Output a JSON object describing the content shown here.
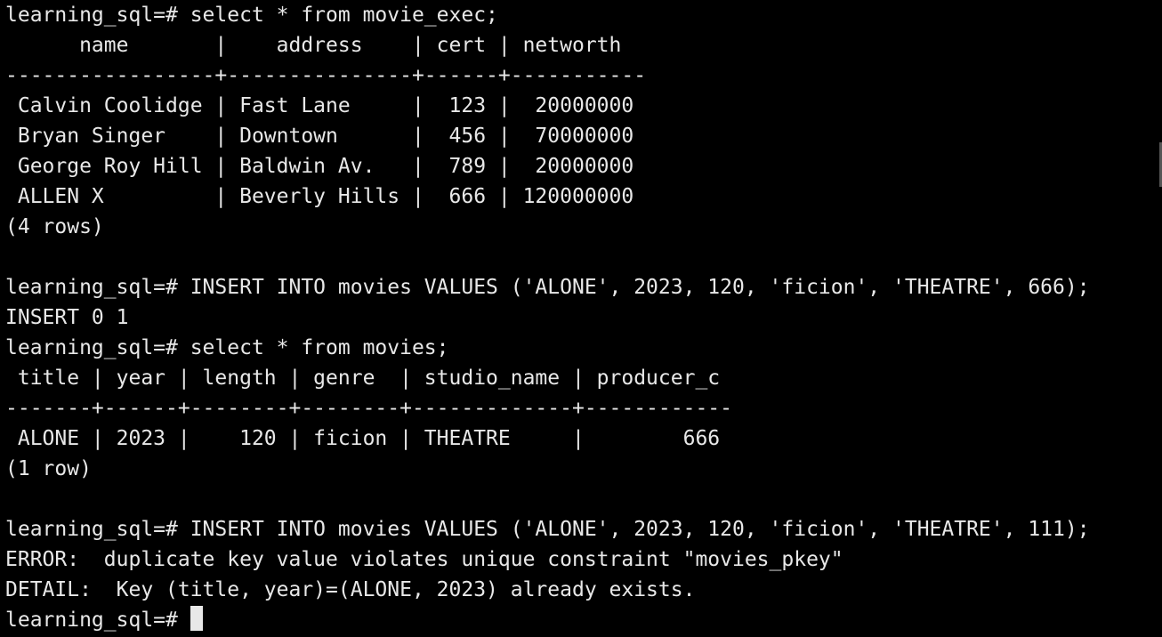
{
  "terminal": {
    "prompt": "learning_sql=# ",
    "lines": [
      "learning_sql=# select * from movie_exec;",
      "      name       |    address    | cert | networth",
      "-----------------+---------------+------+-----------",
      " Calvin Coolidge | Fast Lane     |  123 |  20000000",
      " Bryan Singer    | Downtown      |  456 |  70000000",
      " George Roy Hill | Baldwin Av.   |  789 |  20000000",
      " ALLEN X         | Beverly Hills |  666 | 120000000",
      "(4 rows)",
      "",
      "learning_sql=# INSERT INTO movies VALUES ('ALONE', 2023, 120, 'ficion', 'THEATRE', 666);",
      "INSERT 0 1",
      "learning_sql=# select * from movies;",
      " title | year | length | genre  | studio_name | producer_c",
      "-------+------+--------+--------+-------------+------------",
      " ALONE | 2023 |    120 | ficion | THEATRE     |        666",
      "(1 row)",
      "",
      "learning_sql=# INSERT INTO movies VALUES ('ALONE', 2023, 120, 'ficion', 'THEATRE', 111);",
      "ERROR:  duplicate key value violates unique constraint \"movies_pkey\"",
      "DETAIL:  Key (title, year)=(ALONE, 2023) already exists."
    ]
  }
}
